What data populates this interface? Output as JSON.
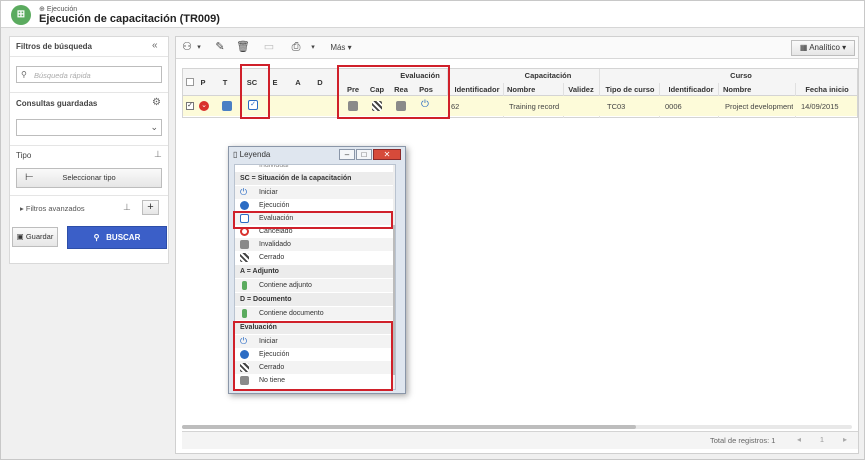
{
  "header": {
    "crumb": "Ejecución",
    "title": "Ejecución de capacitación (TR009)"
  },
  "sidebar": {
    "filters_title": "Filtros de búsqueda",
    "search_placeholder": "Búsqueda rápida",
    "saved_queries": "Consultas guardadas",
    "type_label": "Tipo",
    "select_type": "Seleccionar tipo",
    "advanced": "Filtros avanzados",
    "save": "Guardar",
    "search": "BUSCAR"
  },
  "toolbar": {
    "more": "Más",
    "view": "Analítico"
  },
  "grid": {
    "groups": {
      "evaluation": "Evaluación",
      "training": "Capacitación",
      "course": "Curso"
    },
    "columns": [
      "P",
      "T",
      "SC",
      "E",
      "A",
      "D",
      "Pre",
      "Cap",
      "Rea",
      "Pos",
      "Identificador",
      "Nombre",
      "Validez",
      "Tipo de curso",
      "Identificador",
      "Nombre",
      "Fecha inicio"
    ],
    "row": {
      "id": "62",
      "name": "Training record",
      "validity": "",
      "course_type": "TC03",
      "course_id": "0006",
      "course_name": "Project development",
      "start": "14/09/2015"
    },
    "total": "Total de registros: 1",
    "page": "1"
  },
  "legend": {
    "title": "Leyenda",
    "top_cut": "Individual",
    "sc_header": "SC = Situación de la capacitación",
    "sc_items": [
      "Iniciar",
      "Ejecución",
      "Evaluación",
      "Cancelado",
      "Invalidado",
      "Cerrado"
    ],
    "a_header": "A = Adjunto",
    "a_item": "Contiene adjunto",
    "d_header": "D = Documento",
    "d_item": "Contiene documento",
    "eval_header": "Evaluación",
    "eval_items": [
      "Iniciar",
      "Ejecución",
      "Cerrado",
      "No tiene"
    ]
  },
  "colors": {
    "accent": "#3b5fc8",
    "highlight": "#d0202a",
    "row": "#fdfbd9",
    "brand": "#5bab5f"
  }
}
